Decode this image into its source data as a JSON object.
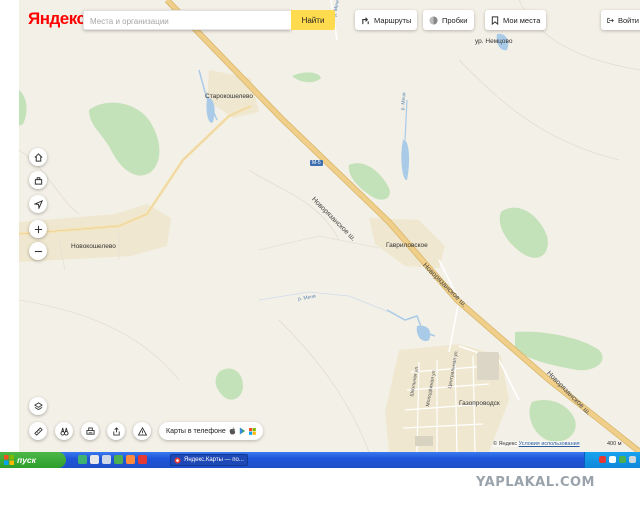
{
  "header": {
    "logo": "Яндекс",
    "search_placeholder": "Места и организации",
    "search_button": "Найти",
    "routes_label": "Маршруты",
    "traffic_label": "Пробки",
    "my_places_label": "Мои места",
    "login_label": "Войти"
  },
  "map": {
    "places": {
      "nemtsovo": "ур. Немцово",
      "starokosheleva": "Старокошелево",
      "novokosheleva": "Новокошелево",
      "gavrilovskoe": "Гавриловское",
      "gazoprovodsk": "Газопроводск"
    },
    "roads": {
      "highway_1": "Новорязанское ш.",
      "highway_2": "Новорязанское ш.",
      "highway_3": "Новорязанское ш.",
      "highway_code": "М-5",
      "street_1": "Школьная ул.",
      "street_2": "Молодёжная ул.",
      "street_3": "Центральная ул."
    },
    "rivers": {
      "mecha": "р. Мечи",
      "river_2": "р. Мечи",
      "river_3": "р. Мечи"
    },
    "colors": {
      "background": "#f3f0e7",
      "forest": "#c4e2b9",
      "water": "#a9cbe8",
      "highway": "#f0cf8a",
      "settlement": "#efe7cf",
      "accent": "#ffdb4d"
    }
  },
  "controls": {
    "phone_promo": "Карты в телефоне",
    "copyright": "© Яндекс",
    "terms": "Условия использования",
    "scale": "400 м"
  },
  "taskbar": {
    "start": "пуск",
    "window_title": "Яндекс.Карты — по...",
    "tray_lang": "RL"
  },
  "watermark": "YAPLAKAL.COM"
}
